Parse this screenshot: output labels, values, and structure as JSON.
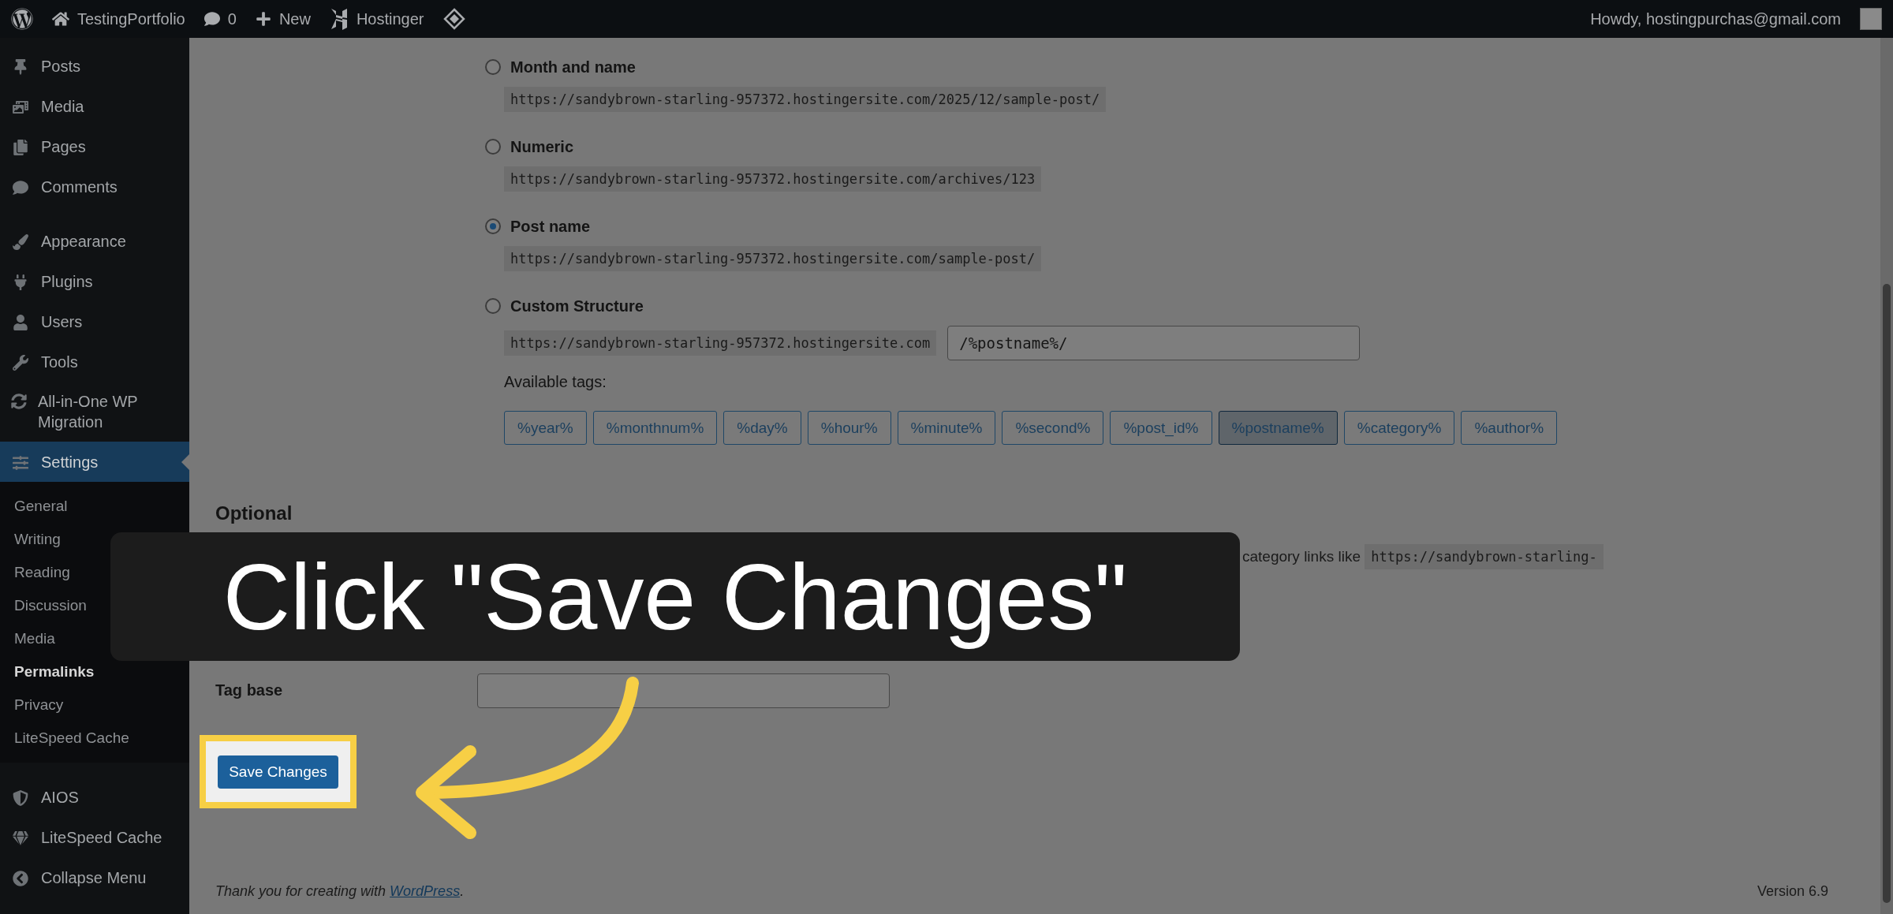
{
  "admin_bar": {
    "site": "TestingPortfolio",
    "comments": "0",
    "new": "New",
    "hostinger": "Hostinger",
    "greeting": "Howdy, hostingpurchas@gmail.com"
  },
  "sidebar": {
    "groups": [
      [
        {
          "label": "Posts",
          "selected": false
        },
        {
          "label": "Media",
          "selected": false
        },
        {
          "label": "Pages",
          "selected": false
        },
        {
          "label": "Comments",
          "selected": false
        }
      ],
      [
        {
          "label": "Appearance",
          "selected": false
        },
        {
          "label": "Plugins",
          "selected": false
        },
        {
          "label": "Users",
          "selected": false
        },
        {
          "label": "Tools",
          "selected": false
        },
        {
          "label": "All-in-One WP Migration",
          "selected": false
        },
        {
          "label": "Settings",
          "selected": true,
          "children": [
            {
              "label": "General",
              "selected": false
            },
            {
              "label": "Writing",
              "selected": false
            },
            {
              "label": "Reading",
              "selected": false
            },
            {
              "label": "Discussion",
              "selected": false
            },
            {
              "label": "Media",
              "selected": false
            },
            {
              "label": "Permalinks",
              "selected": true
            },
            {
              "label": "Privacy",
              "selected": false
            },
            {
              "label": "LiteSpeed Cache",
              "selected": false
            }
          ]
        }
      ],
      [
        {
          "label": "AIOS",
          "selected": false
        },
        {
          "label": "LiteSpeed Cache",
          "selected": false
        },
        {
          "label": "Collapse Menu",
          "selected": false
        }
      ]
    ]
  },
  "permalink_options": [
    {
      "kind": "preset",
      "label": "Month and name",
      "selected": false,
      "url": "https://sandybrown-starling-957372.hostingersite.com/2025/12/sample-post/"
    },
    {
      "kind": "preset",
      "label": "Numeric",
      "selected": false,
      "url": "https://sandybrown-starling-957372.hostingersite.com/archives/123"
    },
    {
      "kind": "preset",
      "label": "Post name",
      "selected": true,
      "url": "https://sandybrown-starling-957372.hostingersite.com/sample-post/"
    },
    {
      "kind": "custom",
      "label": "Custom Structure",
      "selected": false,
      "url": "https://sandybrown-starling-957372.hostingersite.com",
      "value": "/%postname%/"
    }
  ],
  "tags_label": "Available tags:",
  "tags": [
    {
      "label": "%year%",
      "selected": false
    },
    {
      "label": "%monthnum%",
      "selected": false
    },
    {
      "label": "%day%",
      "selected": false
    },
    {
      "label": "%hour%",
      "selected": false
    },
    {
      "label": "%minute%",
      "selected": false
    },
    {
      "label": "%second%",
      "selected": false
    },
    {
      "label": "%post_id%",
      "selected": false
    },
    {
      "label": "%postname%",
      "selected": true
    },
    {
      "label": "%category%",
      "selected": false
    },
    {
      "label": "%author%",
      "selected": false
    }
  ],
  "optional": {
    "heading": "Optional",
    "paragraph": [
      {
        "kind": "text",
        "text": "category links like "
      },
      {
        "kind": "code",
        "text": "https://sandybrown-starling-"
      }
    ],
    "fields": [
      {
        "label": "Tag base"
      }
    ]
  },
  "save_button": "Save Changes",
  "footer": {
    "text": "Thank you for creating with ",
    "link": "WordPress",
    "end": ".",
    "version": "Version 6.9"
  },
  "callout": {
    "text": "Click \"Save Changes\""
  }
}
